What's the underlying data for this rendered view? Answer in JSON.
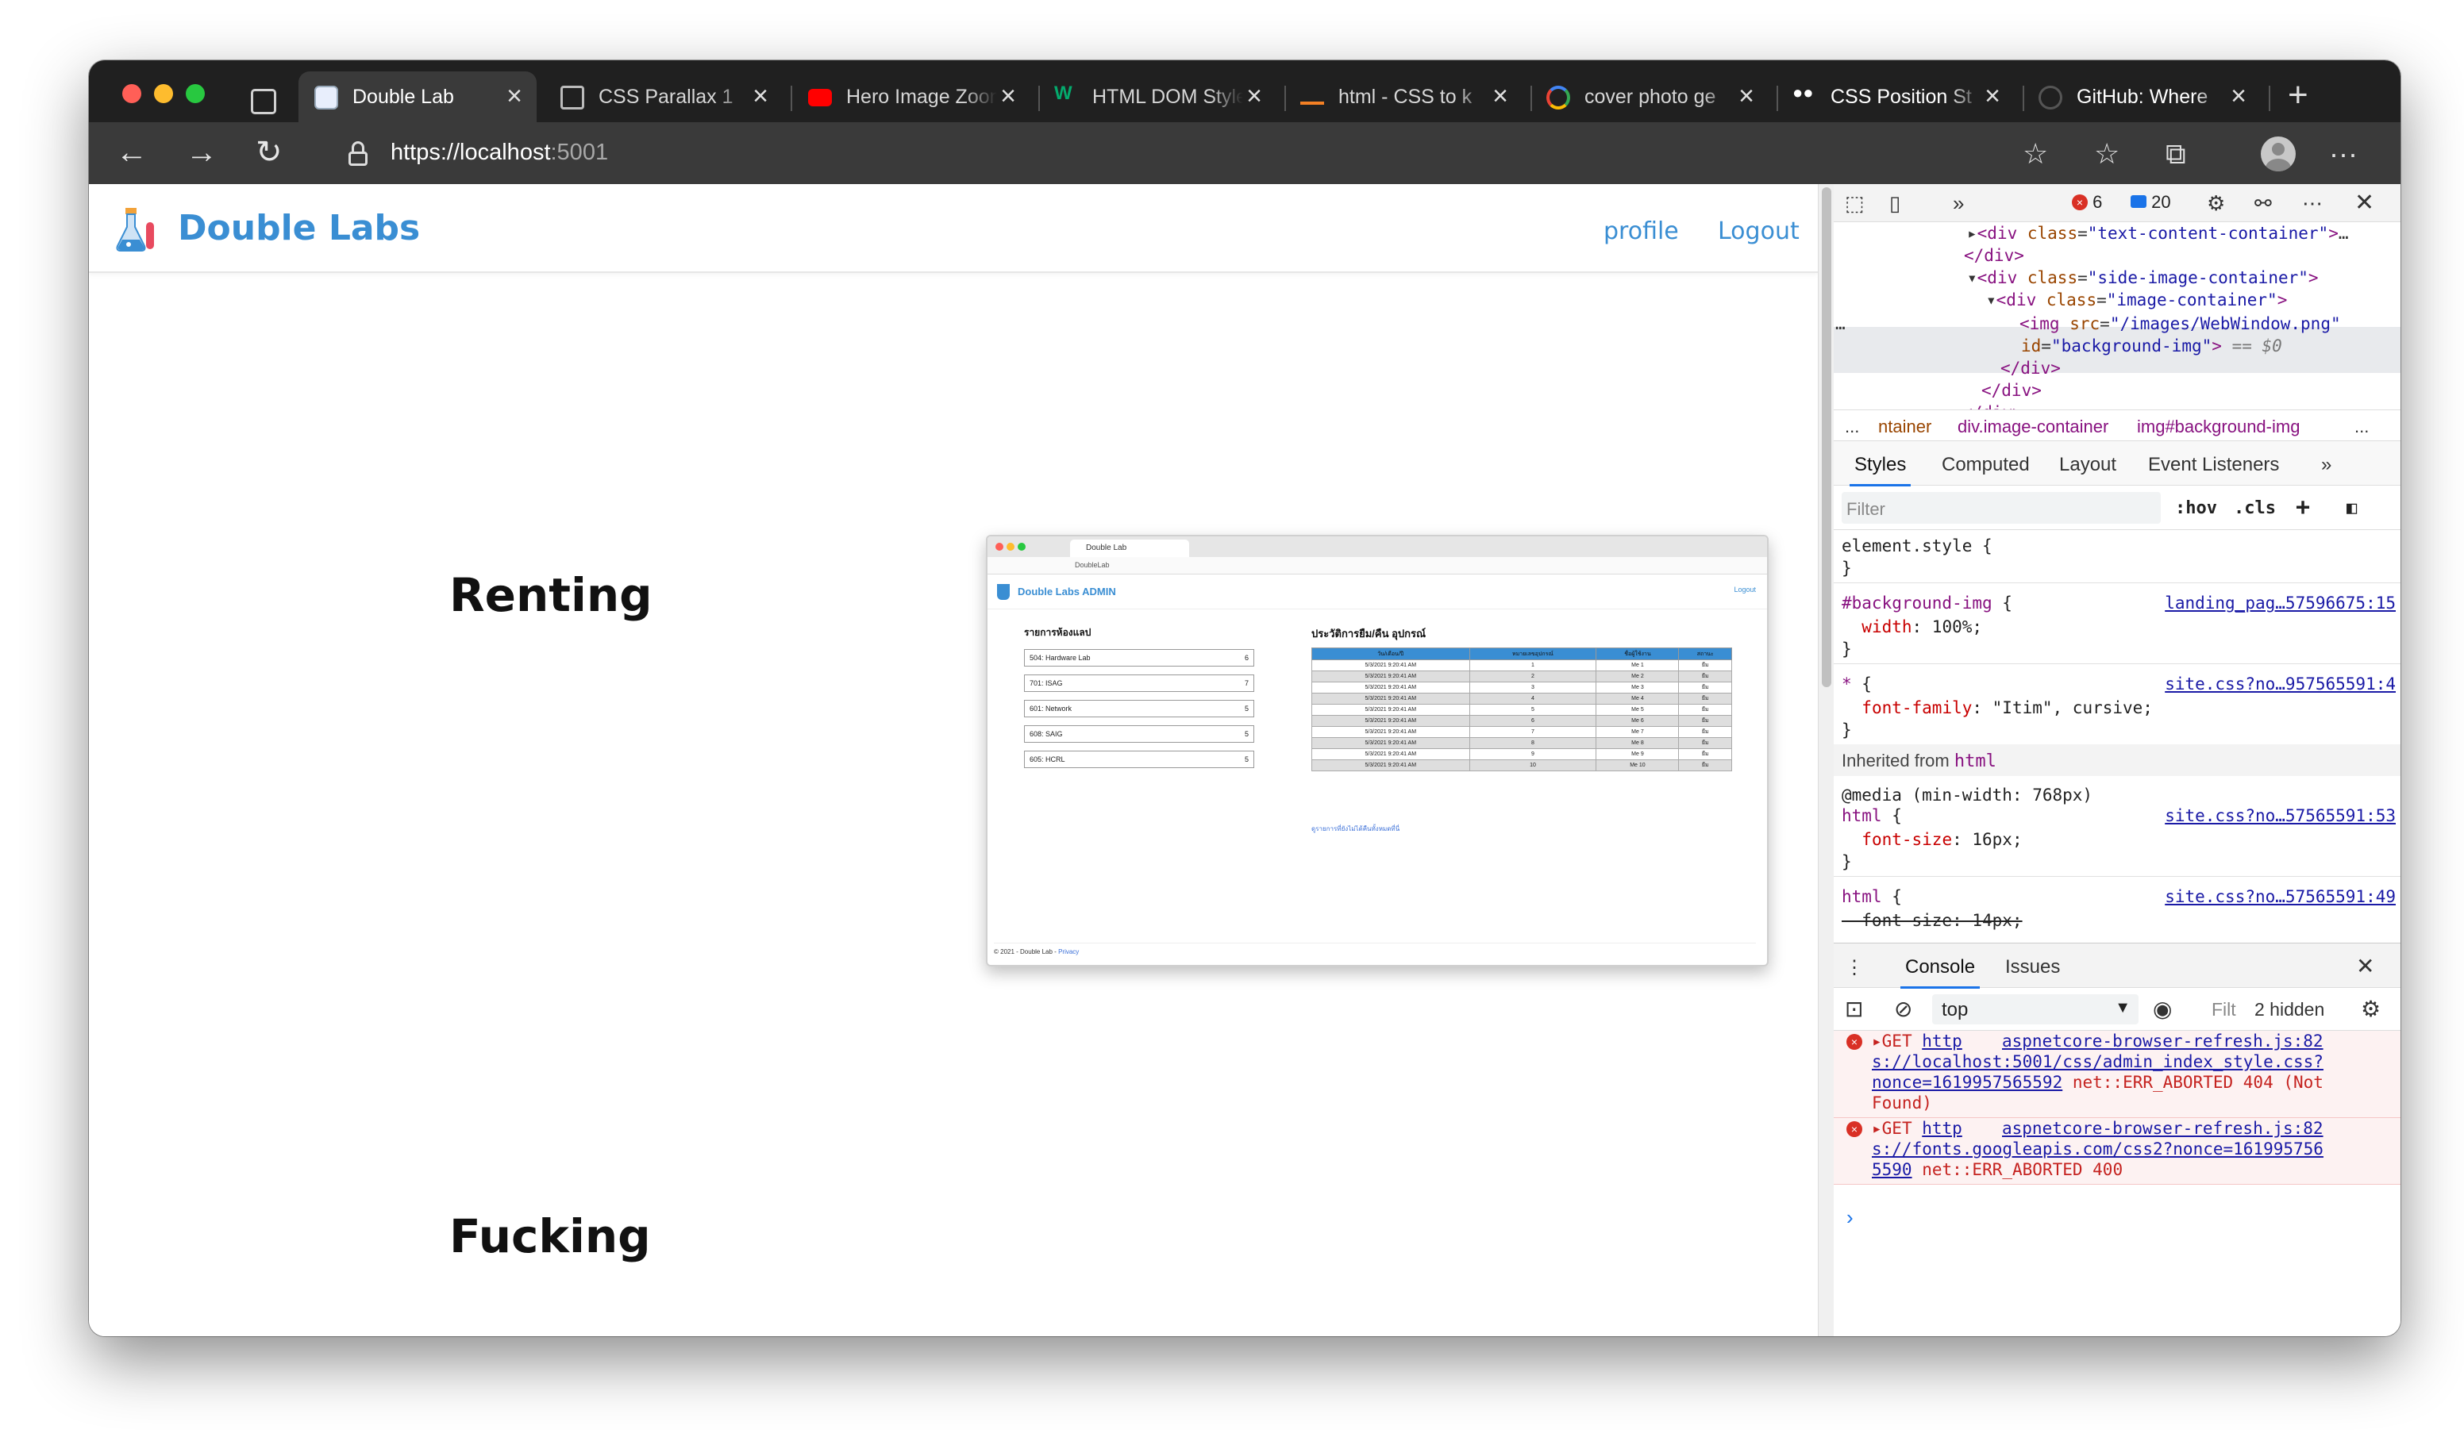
{
  "browser": {
    "tabs": [
      {
        "label": "Double Lab",
        "active": true,
        "favicon": "page-icon"
      },
      {
        "label": "CSS Parallax 1",
        "favicon": "codepen-icon"
      },
      {
        "label": "Hero Image Zoom",
        "favicon": "youtube-icon"
      },
      {
        "label": "HTML DOM Style",
        "favicon": "w3schools-icon"
      },
      {
        "label": "html - CSS to k",
        "favicon": "stackoverflow-icon"
      },
      {
        "label": "cover photo ge",
        "favicon": "google-icon"
      },
      {
        "label": "CSS Position St",
        "favicon": "medium-icon"
      },
      {
        "label": "GitHub: Where",
        "favicon": "github-icon"
      }
    ],
    "url_host": "https://localhost",
    "url_port": ":5001"
  },
  "site": {
    "brand": "Double Labs",
    "profile_alt": "profile",
    "logout": "Logout",
    "headings": [
      "Renting",
      "Fucking"
    ]
  },
  "screenshot": {
    "tab": "Double Lab",
    "url": "DoubleLab",
    "brand": "Double Labs ADMIN",
    "logout": "Logout",
    "labs_title": "รายการห้องแลป",
    "history_title": "ประวัติการยืม/คืน อุปกรณ์",
    "labs": [
      {
        "name": "504: Hardware Lab",
        "count": "6"
      },
      {
        "name": "701: ISAG",
        "count": "7"
      },
      {
        "name": "601: Network",
        "count": "5"
      },
      {
        "name": "608: SAIG",
        "count": "5"
      },
      {
        "name": "605: HCRL",
        "count": "5"
      }
    ],
    "table_headers": [
      "วัน/เดือน/ปี",
      "หมายเลขอุปกรณ์",
      "ชื่อผู้ใช้งาน",
      "สถานะ"
    ],
    "rows": [
      [
        "5/3/2021 9:20:41 AM",
        "1",
        "Me 1",
        "ยืม"
      ],
      [
        "5/3/2021 9:20:41 AM",
        "2",
        "Me 2",
        "ยืม"
      ],
      [
        "5/3/2021 9:20:41 AM",
        "3",
        "Me 3",
        "ยืม"
      ],
      [
        "5/3/2021 9:20:41 AM",
        "4",
        "Me 4",
        "ยืม"
      ],
      [
        "5/3/2021 9:20:41 AM",
        "5",
        "Me 5",
        "ยืม"
      ],
      [
        "5/3/2021 9:20:41 AM",
        "6",
        "Me 6",
        "ยืม"
      ],
      [
        "5/3/2021 9:20:41 AM",
        "7",
        "Me 7",
        "ยืม"
      ],
      [
        "5/3/2021 9:20:41 AM",
        "8",
        "Me 8",
        "ยืม"
      ],
      [
        "5/3/2021 9:20:41 AM",
        "9",
        "Me 9",
        "ยืม"
      ],
      [
        "5/3/2021 9:20:41 AM",
        "10",
        "Me 10",
        "ยืม"
      ]
    ],
    "more_link": "ดูรายการที่ยังไม่ได้คืนทั้งหมดที่นี่",
    "footer": "© 2021 - Double Lab - ",
    "privacy": "Privacy"
  },
  "devtools": {
    "error_count": "6",
    "message_count": "20",
    "breadcrumbs": [
      "...",
      "ntainer",
      "div.image-container",
      "img#background-img",
      "..."
    ],
    "panel_tabs": [
      "Styles",
      "Computed",
      "Layout",
      "Event Listeners"
    ],
    "filter_placeholder": "Filter",
    "hov": ":hov",
    "cls": ".cls",
    "inherited_label": "Inherited from",
    "inherited_tag": "html",
    "drawer_tabs": [
      "Console",
      "Issues"
    ],
    "context": "top",
    "console_filter": "Filt",
    "hidden": "2 hidden",
    "sources": {
      "background_img": "landing_pag…57596675:15",
      "star": "site.css?no…957565591:4",
      "html_media": "site.css?no…57565591:53",
      "html": "site.css?no…57565591:49"
    },
    "errors": [
      {
        "method": "GET ",
        "link": "aspnetcore-browser-refresh.js:82",
        "url": "http\ns://localhost:5001/css/admin_index_style.css?\nnonce=1619957565592",
        "status": " net::ERR_ABORTED 404 (Not\nFound)"
      },
      {
        "method": "GET ",
        "link": "aspnetcore-browser-refresh.js:82",
        "url": "http\ns://fonts.googleapis.com/css2?nonce=161995756\n5590",
        "status": " net::ERR_ABORTED 400"
      }
    ]
  },
  "colors": {
    "accent": "#3a8ed3",
    "error": "#d93025",
    "titlebar": "#202020",
    "toolbar": "#3a3a3a"
  }
}
